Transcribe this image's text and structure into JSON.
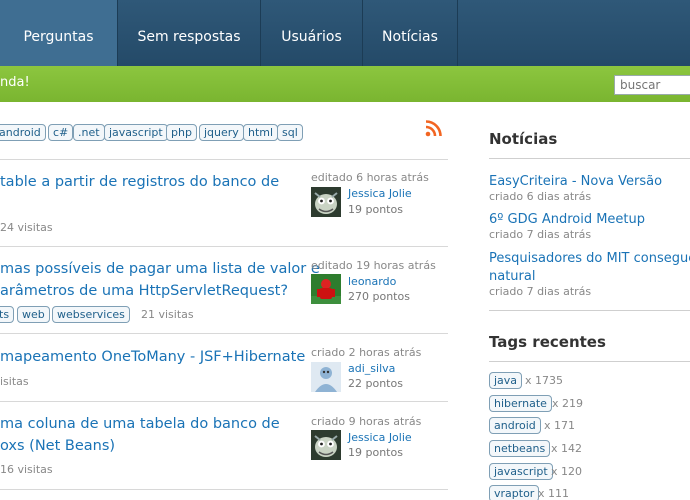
{
  "nav": {
    "items": [
      {
        "label": "Perguntas",
        "active": true
      },
      {
        "label": "Sem respostas",
        "active": false
      },
      {
        "label": "Usuários",
        "active": false
      },
      {
        "label": "Notícias",
        "active": false
      }
    ]
  },
  "banner": {
    "message": "nda!"
  },
  "search": {
    "placeholder": "buscar"
  },
  "tags": [
    "android",
    "c#",
    ".net",
    "javascript",
    "php",
    "jquery",
    "html",
    "sql"
  ],
  "questions": [
    {
      "title_lines": [
        "table a partir de registros do banco de",
        ""
      ],
      "visits": "24 visitas",
      "tags": [],
      "action": "editado 6 horas atrás",
      "user": "Jessica Jolie",
      "points": "19 pontos"
    },
    {
      "title_lines": [
        "mas possíveis de pagar uma lista de valor e",
        "arâmetros de uma HttpServletRequest?"
      ],
      "visits": "21 visitas",
      "tags": [
        "ts",
        "web",
        "webservices"
      ],
      "action": "editado 19 horas atrás",
      "user": "leonardo",
      "points": "270 pontos"
    },
    {
      "title_lines": [
        "mapeamento OneToMany - JSF+Hibernate"
      ],
      "visits": "isitas",
      "tags": [],
      "action": "criado 2 horas atrás",
      "user": "adi_silva",
      "points": "22 pontos"
    },
    {
      "title_lines": [
        "ma coluna de uma tabela do banco de",
        "oxs (Net Beans)"
      ],
      "visits": "16 visitas",
      "tags": [],
      "action": "criado 9 horas atrás",
      "user": "Jessica Jolie",
      "points": "19 pontos"
    }
  ],
  "sidebar": {
    "news_heading": "Notícias",
    "news": [
      {
        "lines": [
          "EasyCriteira - Nova Versão"
        ],
        "date": "criado 6 dias atrás"
      },
      {
        "lines": [
          "6º GDG Android Meetup"
        ],
        "date": "criado 7 dias atrás"
      },
      {
        "lines": [
          "Pesquisadores do MIT conseguem",
          "natural"
        ],
        "date": "criado 7 dias atrás"
      }
    ],
    "tags_heading": "Tags recentes",
    "recent_tags": [
      {
        "name": "java",
        "count": "x 1735"
      },
      {
        "name": "hibernate",
        "count": "x 219"
      },
      {
        "name": "android",
        "count": "x 171"
      },
      {
        "name": "netbeans",
        "count": "x 142"
      },
      {
        "name": "javascript",
        "count": "x 120"
      },
      {
        "name": "vraptor",
        "count": "x 111"
      }
    ]
  },
  "colors": {
    "nav": "#2f5878",
    "nav_active": "#3f6e92",
    "green": "#8cc63f",
    "link": "#1a73b6",
    "rss": "#f26522"
  },
  "icons": [
    "rss-icon",
    "avatar-jessica",
    "avatar-leonardo",
    "avatar-adi",
    "avatar-jessica"
  ]
}
